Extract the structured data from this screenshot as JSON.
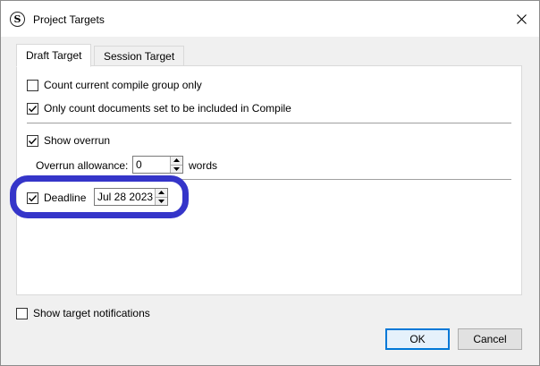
{
  "window": {
    "title": "Project Targets"
  },
  "tabs": [
    {
      "label": "Draft Target",
      "active": true
    },
    {
      "label": "Session Target",
      "active": false
    }
  ],
  "draft": {
    "count_compile_group": {
      "label": "Count current compile group only",
      "checked": false
    },
    "count_included": {
      "label": "Only count documents set to be included in Compile",
      "checked": true
    },
    "show_overrun": {
      "label": "Show overrun",
      "checked": true
    },
    "overrun": {
      "label": "Overrun allowance:",
      "value": "0",
      "unit": "words"
    },
    "deadline": {
      "label": "Deadline",
      "checked": true,
      "value": "Jul 28 2023"
    }
  },
  "footer": {
    "show_notifications": {
      "label": "Show target notifications",
      "checked": false
    },
    "ok_label": "OK",
    "cancel_label": "Cancel"
  },
  "colors": {
    "highlight": "#3535c9",
    "default_button_border": "#0078d7"
  }
}
